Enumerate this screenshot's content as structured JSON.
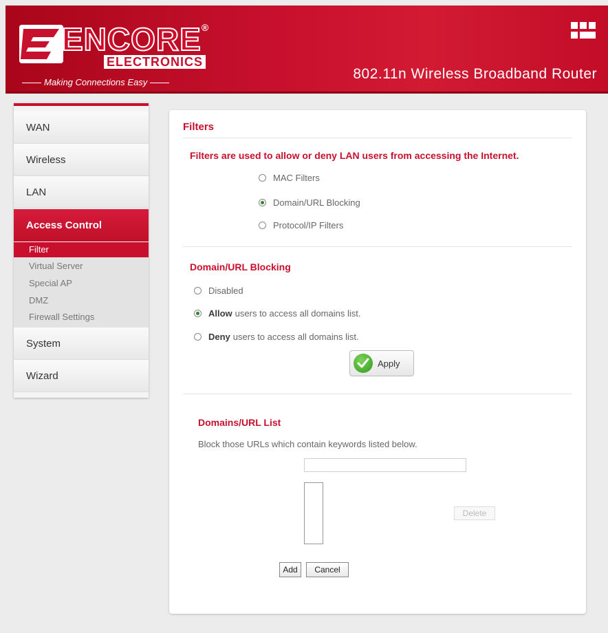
{
  "header": {
    "brand": "ENCORE",
    "brand_sub": "ELECTRONICS",
    "tagline": "Making Connections Easy",
    "product_title": "802.11n Wireless Broadband Router",
    "accent_color": "#c8102e"
  },
  "sidebar": {
    "items": [
      {
        "label": "WAN"
      },
      {
        "label": "Wireless"
      },
      {
        "label": "LAN"
      },
      {
        "label": "Access Control"
      },
      {
        "label": "System"
      },
      {
        "label": "Wizard"
      }
    ],
    "sub_items": [
      {
        "label": "Filter"
      },
      {
        "label": "Virtual Server"
      },
      {
        "label": "Special AP"
      },
      {
        "label": "DMZ"
      },
      {
        "label": "Firewall Settings"
      }
    ]
  },
  "main": {
    "title": "Filters",
    "intro": "Filters are used to allow or deny LAN users from accessing the Internet.",
    "filter_options": [
      {
        "label": "MAC Filters",
        "checked": false
      },
      {
        "label": "Domain/URL Blocking",
        "checked": true
      },
      {
        "label": "Protocol/IP Filters",
        "checked": false
      }
    ],
    "blocking": {
      "heading": "Domain/URL Blocking",
      "options": [
        {
          "bold": "",
          "label": "Disabled",
          "checked": false
        },
        {
          "bold": "Allow",
          "label": "users to access all domains list.",
          "checked": true
        },
        {
          "bold": "Deny",
          "label": "users to access all domains list.",
          "checked": false
        }
      ],
      "apply_label": "Apply"
    },
    "list": {
      "heading": "Domains/URL List",
      "description": "Block those URLs which contain keywords listed below.",
      "input_value": "",
      "delete_label": "Delete",
      "add_label": "Add",
      "cancel_label": "Cancel"
    }
  }
}
